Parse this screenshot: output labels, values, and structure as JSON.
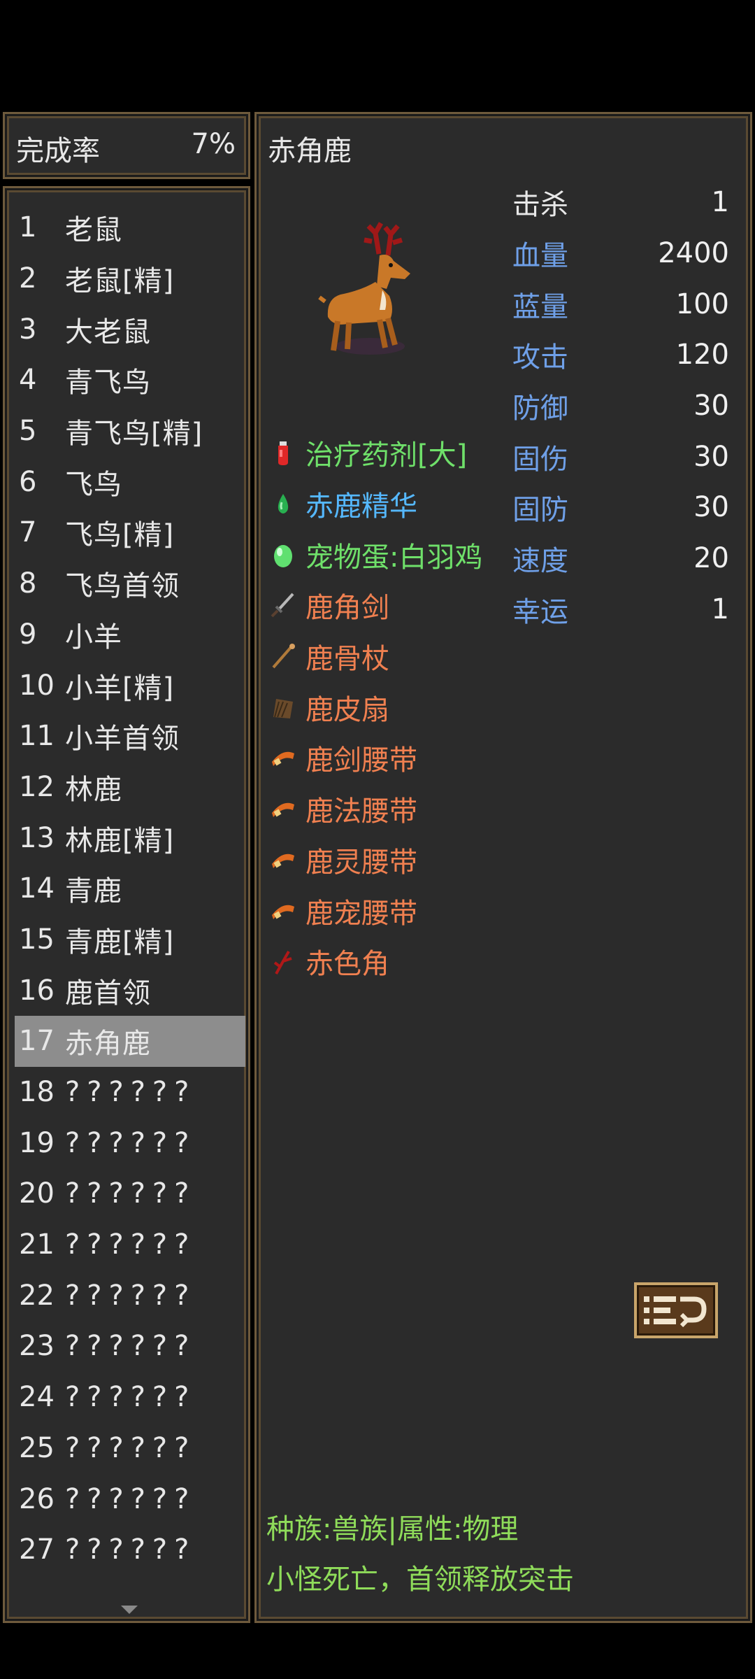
{
  "completion": {
    "label": "完成率",
    "value": "7%"
  },
  "bestiary": [
    {
      "num": "1",
      "name": "老鼠"
    },
    {
      "num": "2",
      "name": "老鼠[精]"
    },
    {
      "num": "3",
      "name": "大老鼠"
    },
    {
      "num": "4",
      "name": "青飞鸟"
    },
    {
      "num": "5",
      "name": "青飞鸟[精]"
    },
    {
      "num": "6",
      "name": "飞鸟"
    },
    {
      "num": "7",
      "name": "飞鸟[精]"
    },
    {
      "num": "8",
      "name": "飞鸟首领"
    },
    {
      "num": "9",
      "name": "小羊"
    },
    {
      "num": "10",
      "name": "小羊[精]"
    },
    {
      "num": "11",
      "name": "小羊首领"
    },
    {
      "num": "12",
      "name": "林鹿"
    },
    {
      "num": "13",
      "name": "林鹿[精]"
    },
    {
      "num": "14",
      "name": "青鹿"
    },
    {
      "num": "15",
      "name": "青鹿[精]"
    },
    {
      "num": "16",
      "name": "鹿首领"
    },
    {
      "num": "17",
      "name": "赤角鹿"
    },
    {
      "num": "18",
      "name": "??????"
    },
    {
      "num": "19",
      "name": "??????"
    },
    {
      "num": "20",
      "name": "??????"
    },
    {
      "num": "21",
      "name": "??????"
    },
    {
      "num": "22",
      "name": "??????"
    },
    {
      "num": "23",
      "name": "??????"
    },
    {
      "num": "24",
      "name": "??????"
    },
    {
      "num": "25",
      "name": "??????"
    },
    {
      "num": "26",
      "name": "??????"
    },
    {
      "num": "27",
      "name": "??????"
    }
  ],
  "monster": {
    "name": "赤角鹿",
    "stats": [
      {
        "label": "击杀",
        "value": "1",
        "color": "white"
      },
      {
        "label": "血量",
        "value": "2400",
        "color": "blue"
      },
      {
        "label": "蓝量",
        "value": "100",
        "color": "blue"
      },
      {
        "label": "攻击",
        "value": "120",
        "color": "blue"
      },
      {
        "label": "防御",
        "value": "30",
        "color": "blue"
      },
      {
        "label": "固伤",
        "value": "30",
        "color": "blue"
      },
      {
        "label": "固防",
        "value": "30",
        "color": "blue"
      },
      {
        "label": "速度",
        "value": "20",
        "color": "blue"
      },
      {
        "label": "幸运",
        "value": "1",
        "color": "blue"
      }
    ],
    "drops": [
      {
        "name": "治疗药剂[大]",
        "color": "#6fe06a",
        "icon": "red-potion-icon"
      },
      {
        "name": "赤鹿精华",
        "color": "#55b8ff",
        "icon": "green-essence-icon"
      },
      {
        "name": "宠物蛋:白羽鸡",
        "color": "#6fe06a",
        "icon": "green-egg-icon"
      },
      {
        "name": "鹿角剑",
        "color": "#f08050",
        "icon": "sword-icon"
      },
      {
        "name": "鹿骨杖",
        "color": "#f08050",
        "icon": "staff-icon"
      },
      {
        "name": "鹿皮扇",
        "color": "#f08050",
        "icon": "fan-icon"
      },
      {
        "name": "鹿剑腰带",
        "color": "#f08050",
        "icon": "belt-icon"
      },
      {
        "name": "鹿法腰带",
        "color": "#f08050",
        "icon": "belt-icon"
      },
      {
        "name": "鹿灵腰带",
        "color": "#f08050",
        "icon": "belt-icon"
      },
      {
        "name": "鹿宠腰带",
        "color": "#f08050",
        "icon": "belt-icon"
      },
      {
        "name": "赤色角",
        "color": "#f08050",
        "icon": "red-horn-icon"
      }
    ],
    "race_info": "种族:兽族|属性:物理",
    "skill_info": "小怪死亡，首领释放突击"
  },
  "selected_index": 16
}
